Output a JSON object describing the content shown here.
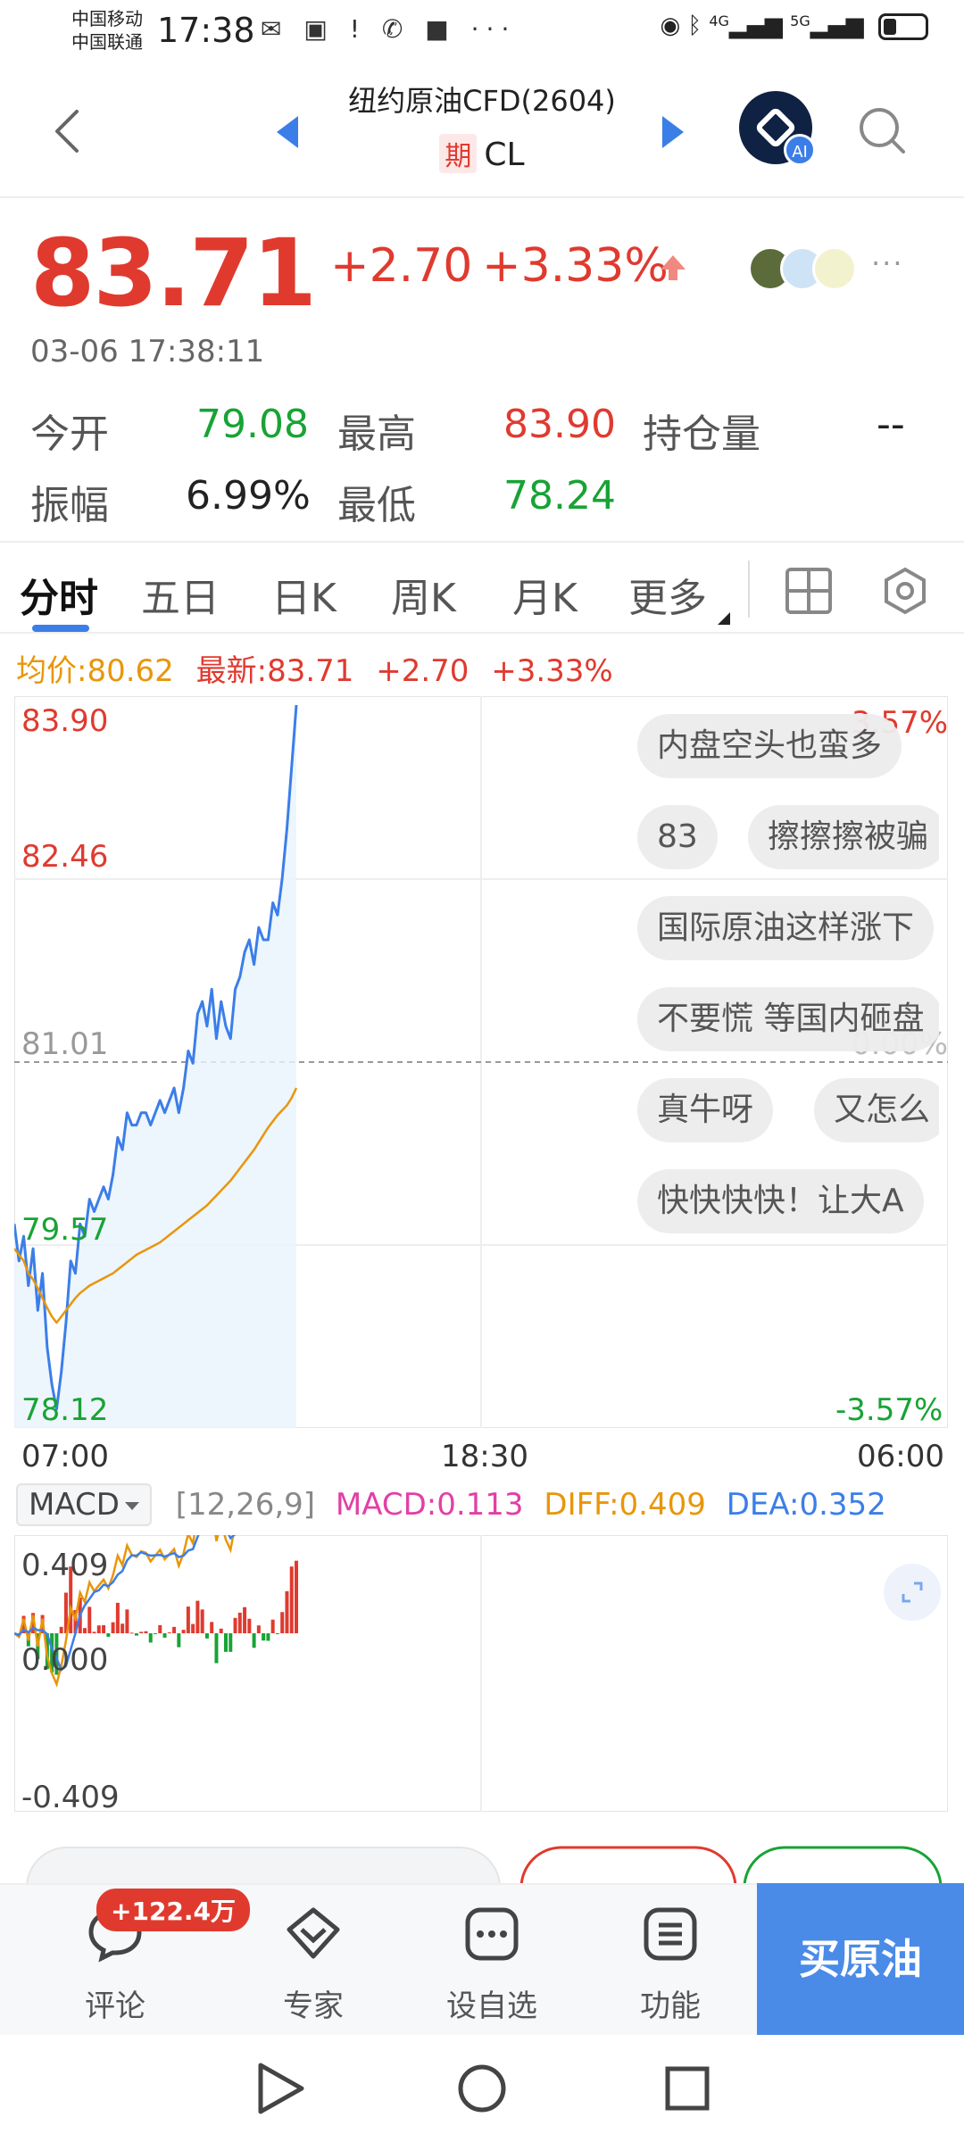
{
  "status": {
    "carrier1": "中国移动",
    "carrier2": "中国联通",
    "time": "17:38",
    "signal1": "4G",
    "signal2": "5G"
  },
  "nav": {
    "title": "纽约原油CFD(2604)",
    "tag": "期",
    "symbol": "CL",
    "ai_badge": "AI"
  },
  "quote": {
    "price": "83.71",
    "change": "+2.70",
    "change_pct": "+3.33%",
    "timestamp": "03-06 17:38:11",
    "more": "···"
  },
  "stats": {
    "open_label": "今开",
    "open": "79.08",
    "high_label": "最高",
    "high": "83.90",
    "oi_label": "持仓量",
    "oi": "--",
    "amp_label": "振幅",
    "amp": "6.99%",
    "low_label": "最低",
    "low": "78.24"
  },
  "tabs": [
    "分时",
    "五日",
    "日K",
    "周K",
    "月K",
    "更多"
  ],
  "chart_info": {
    "avg": "均价:80.62",
    "latest": "最新:83.71",
    "chg": "+2.70",
    "pct": "+3.33%"
  },
  "chart_data": {
    "type": "line",
    "title": "",
    "series": [
      {
        "values": [
          79.7,
          79.4,
          79.6,
          79.2,
          79.5,
          79.0,
          79.3,
          78.7,
          78.4,
          78.2,
          78.5,
          78.9,
          79.4,
          79.3,
          79.7,
          79.6,
          79.9,
          79.8,
          79.9,
          80.0,
          79.9,
          80.1,
          80.4,
          80.3,
          80.6,
          80.5,
          80.5,
          80.6,
          80.6,
          80.5,
          80.6,
          80.7,
          80.6,
          80.7,
          80.8,
          80.6,
          80.8,
          81.1,
          81.0,
          81.4,
          81.5,
          81.3,
          81.6,
          81.2,
          81.5,
          81.3,
          81.2,
          81.6,
          81.7,
          81.9,
          82.0,
          81.8,
          82.1,
          82.0,
          82.0,
          82.3,
          82.2,
          82.5,
          82.9,
          83.4,
          83.9
        ]
      },
      {
        "values": [
          79.5,
          79.45,
          79.4,
          79.3,
          79.25,
          79.18,
          79.1,
          79.02,
          78.95,
          78.9,
          78.95,
          79.0,
          79.05,
          79.1,
          79.14,
          79.17,
          79.2,
          79.22,
          79.24,
          79.26,
          79.28,
          79.3,
          79.33,
          79.36,
          79.39,
          79.42,
          79.45,
          79.47,
          79.49,
          79.51,
          79.53,
          79.55,
          79.58,
          79.61,
          79.64,
          79.67,
          79.7,
          79.73,
          79.76,
          79.79,
          79.82,
          79.85,
          79.89,
          79.93,
          79.97,
          80.01,
          80.05,
          80.1,
          80.15,
          80.2,
          80.25,
          80.3,
          80.36,
          80.42,
          80.48,
          80.53,
          80.58,
          80.62,
          80.66,
          80.72,
          80.8
        ]
      }
    ],
    "y_labels_left": [
      "83.90",
      "82.46",
      "81.01",
      "79.57",
      "78.12"
    ],
    "y_labels_right": [
      "3.57%",
      "0.00%",
      "-3.57%"
    ],
    "x_labels": [
      "07:00",
      "18:30",
      "06:00"
    ],
    "ylim": [
      78.12,
      83.9
    ]
  },
  "comments": [
    "内盘空头也蛮多",
    "83",
    "擦擦擦被骗",
    "国际原油这样涨下",
    "不要慌 等国内砸盘",
    "真牛呀",
    "又怎么",
    "快快快快！让大A"
  ],
  "macd": {
    "name": "MACD",
    "params": "[12,26,9]",
    "macd": "MACD:0.113",
    "diff": "DIFF:0.409",
    "dea": "DEA:0.352",
    "y_top": "0.409",
    "y_mid": "0.000",
    "y_bot": "-0.409",
    "colors": {
      "macd": "#e23fa6",
      "diff": "#e8960a",
      "dea": "#3b7ee8"
    }
  },
  "bottom": {
    "comment_count": "+122.4万",
    "comment": "评论",
    "expert": "专家",
    "watchlist": "设自选",
    "function": "功能",
    "buy": "买原油"
  },
  "colors": {
    "up": "#e03a2f",
    "down": "#18a335",
    "accent": "#3b7ee8",
    "avg": "#e8960a"
  }
}
